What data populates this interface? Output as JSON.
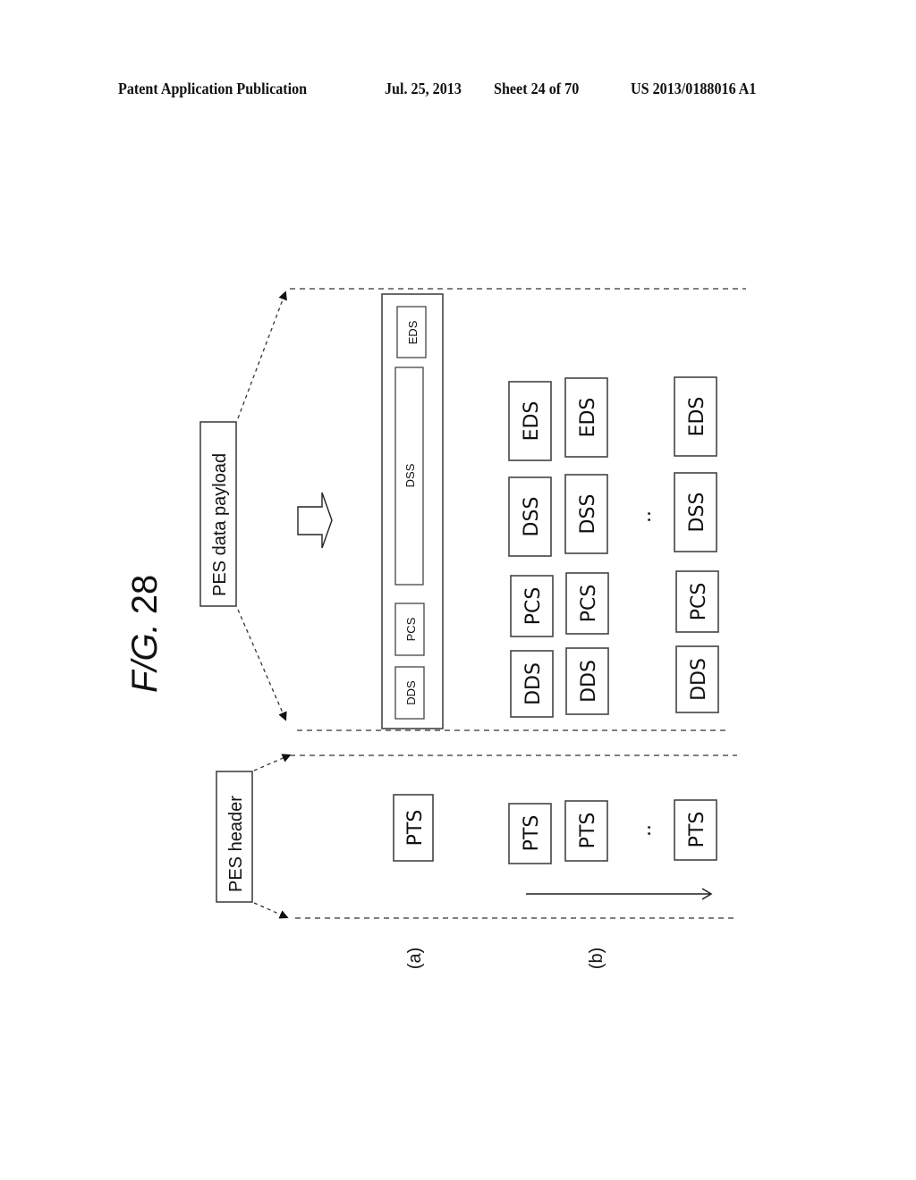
{
  "header": {
    "publication": "Patent Application Publication",
    "date": "Jul. 25, 2013",
    "sheet": "Sheet 24 of 70",
    "patent_number": "US 2013/0188016 A1"
  },
  "figure": {
    "title": "FIG. 28",
    "title_prefix": "F/G.",
    "title_number": "28",
    "labels": {
      "pes_data_payload": "PES data payload",
      "pes_header": "PES header",
      "part_a": "(a)",
      "part_b": "(b)"
    },
    "part_a": {
      "header_segment": "PTS",
      "payload_segments": [
        "DDS",
        "PCS",
        "DSS",
        "EDS"
      ]
    },
    "part_b": {
      "header_segments": [
        "PTS",
        "PTS",
        "PTS"
      ],
      "ellipsis": "..",
      "segment_columns": [
        {
          "DDS": "DDS",
          "PCS": "PCS",
          "DSS": "DSS",
          "EDS": "EDS"
        },
        {
          "DDS": "DDS",
          "PCS": "PCS",
          "DSS": "DSS",
          "EDS": "EDS"
        },
        {
          "DDS": "DDS",
          "PCS": "PCS",
          "DSS": "DSS",
          "EDS": "EDS"
        }
      ]
    }
  }
}
